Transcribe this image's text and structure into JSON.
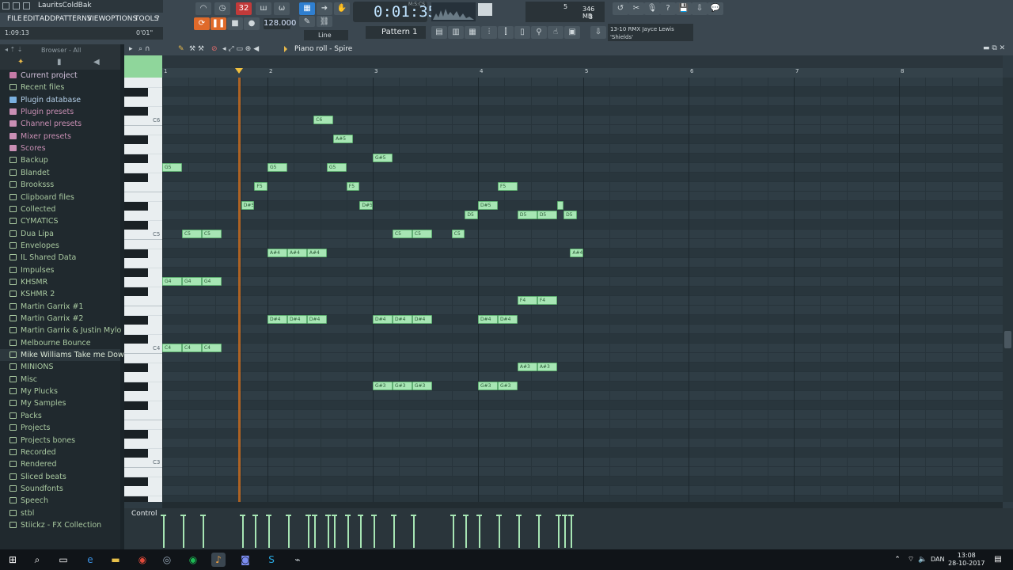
{
  "window": {
    "title": "LauritsColdBak"
  },
  "menu": [
    "FILE",
    "EDIT",
    "ADD",
    "PATTERNS",
    "VIEW",
    "OPTIONS",
    "TOOLS",
    "?"
  ],
  "hint": {
    "left": "1:09:13",
    "right": "0'01\""
  },
  "transport": {
    "time": "0:01:35",
    "time_label": "M:S:CS",
    "tempo": "128.000",
    "pattern": "Pattern 1",
    "snap": "Line"
  },
  "cpu": {
    "cpu": "5",
    "ram": "346 MB",
    "poly": "3"
  },
  "hint_panel": {
    "line1": "13-10 RMX Jayce Lewis",
    "line2": "'Shields'"
  },
  "browser": {
    "header": "Browser - All",
    "items": [
      {
        "label": "Current project",
        "kind": "special"
      },
      {
        "label": "Recent files",
        "kind": "folder"
      },
      {
        "label": "Plugin database",
        "kind": "plugdb"
      },
      {
        "label": "Plugin presets",
        "kind": "pink"
      },
      {
        "label": "Channel presets",
        "kind": "pink"
      },
      {
        "label": "Mixer presets",
        "kind": "pink"
      },
      {
        "label": "Scores",
        "kind": "pink"
      },
      {
        "label": "Backup",
        "kind": "folder"
      },
      {
        "label": "Blandet",
        "kind": "folder"
      },
      {
        "label": "Brooksss",
        "kind": "folder"
      },
      {
        "label": "Clipboard files",
        "kind": "folder"
      },
      {
        "label": "Collected",
        "kind": "folder"
      },
      {
        "label": "CYMATICS",
        "kind": "folder"
      },
      {
        "label": "Dua Lipa",
        "kind": "folder"
      },
      {
        "label": "Envelopes",
        "kind": "folder"
      },
      {
        "label": "IL Shared Data",
        "kind": "folder"
      },
      {
        "label": "Impulses",
        "kind": "folder"
      },
      {
        "label": "KHSMR",
        "kind": "folder"
      },
      {
        "label": "KSHMR 2",
        "kind": "folder"
      },
      {
        "label": "Martin Garrix #1",
        "kind": "folder"
      },
      {
        "label": "Martin Garrix #2",
        "kind": "folder"
      },
      {
        "label": "Martin Garrix & Justin Mylo ID",
        "kind": "folder"
      },
      {
        "label": "Melbourne Bounce",
        "kind": "folder"
      },
      {
        "label": "Mike Williams Take me Down",
        "kind": "folder"
      },
      {
        "label": "MINIONS",
        "kind": "folder"
      },
      {
        "label": "Misc",
        "kind": "folder"
      },
      {
        "label": "My Plucks",
        "kind": "folder"
      },
      {
        "label": "My Samples",
        "kind": "folder"
      },
      {
        "label": "Packs",
        "kind": "folder"
      },
      {
        "label": "Projects",
        "kind": "folder"
      },
      {
        "label": "Projects bones",
        "kind": "folder"
      },
      {
        "label": "Recorded",
        "kind": "folder"
      },
      {
        "label": "Rendered",
        "kind": "folder"
      },
      {
        "label": "Sliced beats",
        "kind": "folder"
      },
      {
        "label": "Soundfonts",
        "kind": "folder"
      },
      {
        "label": "Speech",
        "kind": "folder"
      },
      {
        "label": "stbl",
        "kind": "folder"
      },
      {
        "label": "Stiickz - FX Collection",
        "kind": "folder"
      }
    ],
    "selected": "Mike Williams Take me Down"
  },
  "pianoroll": {
    "title": "Piano roll - Spire",
    "bars": [
      "1",
      "2",
      "3",
      "4",
      "5",
      "6",
      "7",
      "8"
    ],
    "control_label": "Control",
    "top_note": "E6",
    "key_labels": [
      "C6",
      "C5",
      "C4",
      "C3"
    ],
    "notes": [
      {
        "pitch": "C6",
        "start": 1.4375,
        "len": 0.1875,
        "label": "C6"
      },
      {
        "pitch": "A#5",
        "start": 1.625,
        "len": 0.1875,
        "label": "A#5"
      },
      {
        "pitch": "G#5",
        "start": 2.0,
        "len": 0.1875,
        "label": "G#5"
      },
      {
        "pitch": "G5",
        "start": 0.0,
        "len": 0.1875,
        "label": "G5"
      },
      {
        "pitch": "G5",
        "start": 1.0,
        "len": 0.1875,
        "label": "G5"
      },
      {
        "pitch": "G5",
        "start": 1.5625,
        "len": 0.1875,
        "label": "G5"
      },
      {
        "pitch": "F5",
        "start": 0.875,
        "len": 0.125,
        "label": "F5"
      },
      {
        "pitch": "F5",
        "start": 1.75,
        "len": 0.125,
        "label": "F5"
      },
      {
        "pitch": "F5",
        "start": 3.1875,
        "len": 0.1875,
        "label": "F5"
      },
      {
        "pitch": "D#5",
        "start": 0.75,
        "len": 0.125,
        "label": "D#5"
      },
      {
        "pitch": "D#5",
        "start": 1.875,
        "len": 0.125,
        "label": "D#5"
      },
      {
        "pitch": "D#5",
        "start": 3.0,
        "len": 0.1875,
        "label": "D#5"
      },
      {
        "pitch": "D#5",
        "start": 3.75,
        "len": 0.0625,
        "label": ""
      },
      {
        "pitch": "D5",
        "start": 2.875,
        "len": 0.125,
        "label": "D5"
      },
      {
        "pitch": "D5",
        "start": 3.375,
        "len": 0.1875,
        "label": "D5"
      },
      {
        "pitch": "D5",
        "start": 3.5625,
        "len": 0.1875,
        "label": "D5"
      },
      {
        "pitch": "D5",
        "start": 3.8125,
        "len": 0.125,
        "label": "D5"
      },
      {
        "pitch": "C5",
        "start": 0.1875,
        "len": 0.1875,
        "label": "C5"
      },
      {
        "pitch": "C5",
        "start": 0.375,
        "len": 0.1875,
        "label": "C5"
      },
      {
        "pitch": "C5",
        "start": 2.1875,
        "len": 0.1875,
        "label": "C5"
      },
      {
        "pitch": "C5",
        "start": 2.375,
        "len": 0.1875,
        "label": "C5"
      },
      {
        "pitch": "C5",
        "start": 2.75,
        "len": 0.125,
        "label": "C5"
      },
      {
        "pitch": "A#4",
        "start": 1.0,
        "len": 0.1875,
        "label": "A#4"
      },
      {
        "pitch": "A#4",
        "start": 1.1875,
        "len": 0.1875,
        "label": "A#4"
      },
      {
        "pitch": "A#4",
        "start": 1.375,
        "len": 0.1875,
        "label": "A#4"
      },
      {
        "pitch": "A#4",
        "start": 3.875,
        "len": 0.125,
        "label": "A#4"
      },
      {
        "pitch": "G4",
        "start": 0.0,
        "len": 0.1875,
        "label": "G4"
      },
      {
        "pitch": "G4",
        "start": 0.1875,
        "len": 0.1875,
        "label": "G4"
      },
      {
        "pitch": "G4",
        "start": 0.375,
        "len": 0.1875,
        "label": "G4"
      },
      {
        "pitch": "F4",
        "start": 3.375,
        "len": 0.1875,
        "label": "F4"
      },
      {
        "pitch": "F4",
        "start": 3.5625,
        "len": 0.1875,
        "label": "F4"
      },
      {
        "pitch": "D#4",
        "start": 1.0,
        "len": 0.1875,
        "label": "D#4"
      },
      {
        "pitch": "D#4",
        "start": 1.1875,
        "len": 0.1875,
        "label": "D#4"
      },
      {
        "pitch": "D#4",
        "start": 1.375,
        "len": 0.1875,
        "label": "D#4"
      },
      {
        "pitch": "D#4",
        "start": 2.0,
        "len": 0.1875,
        "label": "D#4"
      },
      {
        "pitch": "D#4",
        "start": 2.1875,
        "len": 0.1875,
        "label": "D#4"
      },
      {
        "pitch": "D#4",
        "start": 2.375,
        "len": 0.1875,
        "label": "D#4"
      },
      {
        "pitch": "D#4",
        "start": 3.0,
        "len": 0.1875,
        "label": "D#4"
      },
      {
        "pitch": "D#4",
        "start": 3.1875,
        "len": 0.1875,
        "label": "D#4"
      },
      {
        "pitch": "C4",
        "start": 0.0,
        "len": 0.1875,
        "label": "C4"
      },
      {
        "pitch": "C4",
        "start": 0.1875,
        "len": 0.1875,
        "label": "C4"
      },
      {
        "pitch": "C4",
        "start": 0.375,
        "len": 0.1875,
        "label": "C4"
      },
      {
        "pitch": "A#3",
        "start": 3.375,
        "len": 0.1875,
        "label": "A#3"
      },
      {
        "pitch": "A#3",
        "start": 3.5625,
        "len": 0.1875,
        "label": "A#3"
      },
      {
        "pitch": "G#3",
        "start": 2.0,
        "len": 0.1875,
        "label": "G#3"
      },
      {
        "pitch": "G#3",
        "start": 2.1875,
        "len": 0.1875,
        "label": "G#3"
      },
      {
        "pitch": "G#3",
        "start": 2.375,
        "len": 0.1875,
        "label": "G#3"
      },
      {
        "pitch": "G#3",
        "start": 3.0,
        "len": 0.1875,
        "label": "G#3"
      },
      {
        "pitch": "G#3",
        "start": 3.1875,
        "len": 0.1875,
        "label": "G#3"
      }
    ],
    "playhead_bar": 0.72
  },
  "taskbar": {
    "lang": "DAN",
    "time": "13:08",
    "date": "28-10-2017"
  },
  "colors": {
    "note": "#a7e6b4",
    "playhead": "#c46a1e",
    "accent": "#e06a2a"
  }
}
